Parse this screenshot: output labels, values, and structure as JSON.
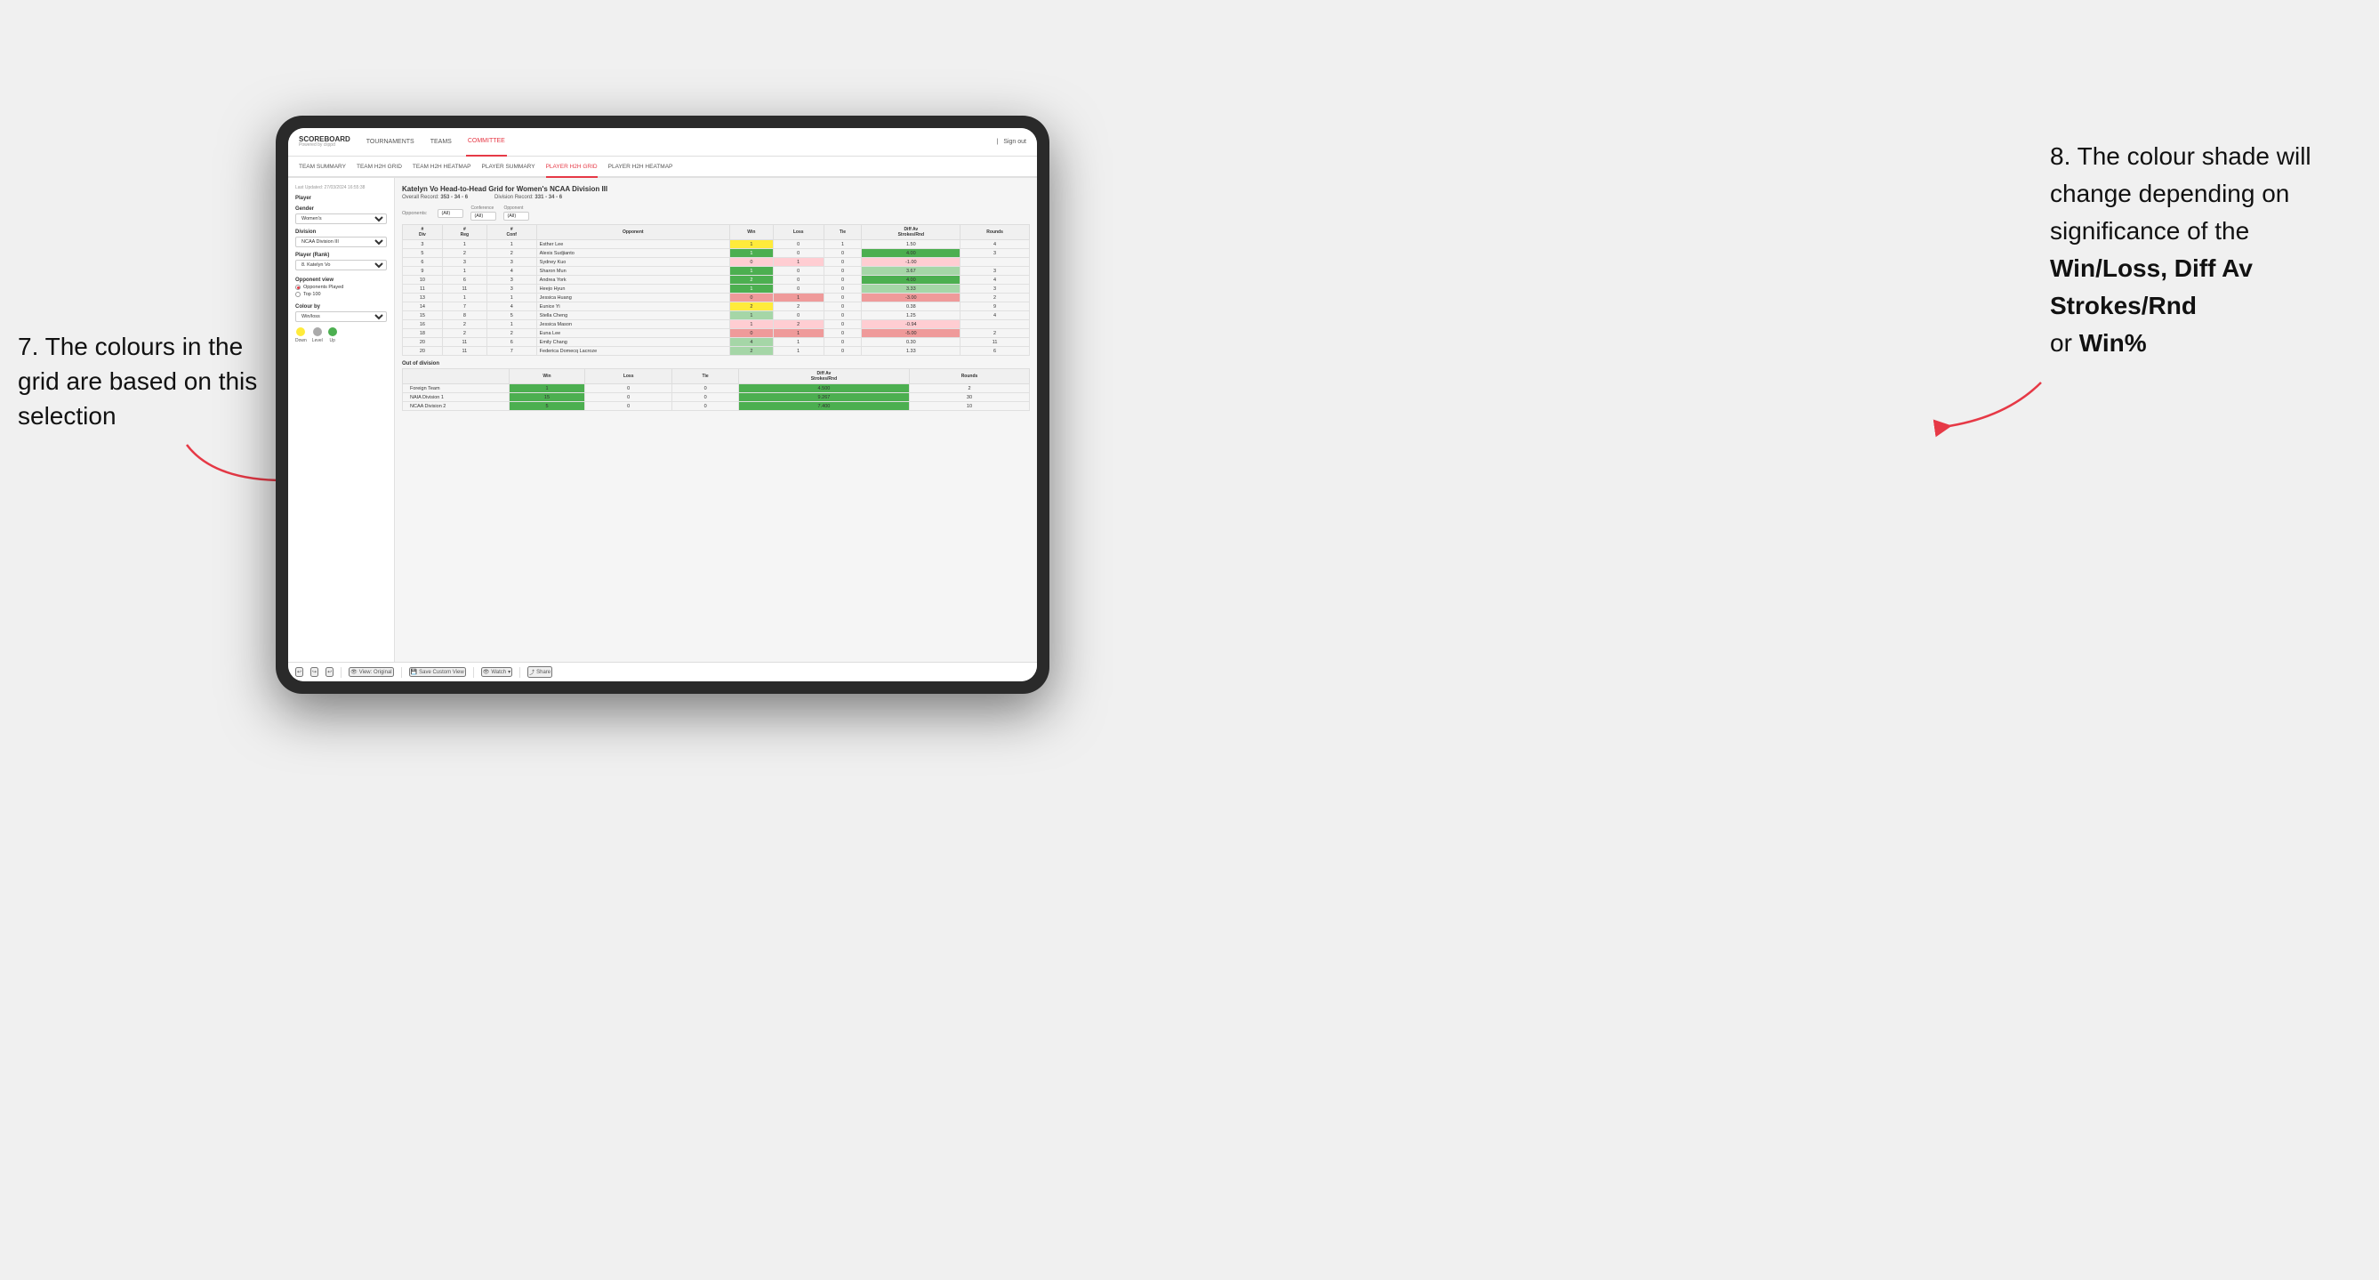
{
  "annotations": {
    "left_title": "7. The colours in the grid are based on this selection",
    "right_title": "8. The colour shade will change depending on significance of the",
    "right_bold1": "Win/Loss,",
    "right_bold2": "Diff Av Strokes/Rnd",
    "right_text": "or",
    "right_bold3": "Win%"
  },
  "nav": {
    "logo": "SCOREBOARD",
    "logo_sub": "Powered by clippd",
    "items": [
      "TOURNAMENTS",
      "TEAMS",
      "COMMITTEE"
    ],
    "active": "COMMITTEE",
    "right": "Sign out"
  },
  "sub_nav": {
    "items": [
      "TEAM SUMMARY",
      "TEAM H2H GRID",
      "TEAM H2H HEATMAP",
      "PLAYER SUMMARY",
      "PLAYER H2H GRID",
      "PLAYER H2H HEATMAP"
    ],
    "active": "PLAYER H2H GRID"
  },
  "sidebar": {
    "timestamp": "Last Updated: 27/03/2024 16:55:38",
    "player_label": "Player",
    "gender_label": "Gender",
    "gender_value": "Women's",
    "division_label": "Division",
    "division_value": "NCAA Division III",
    "player_rank_label": "Player (Rank)",
    "player_rank_value": "8. Katelyn Vo",
    "opponent_view_label": "Opponent view",
    "radio1": "Opponents Played",
    "radio2": "Top 100",
    "radio1_selected": true,
    "colour_by_label": "Colour by",
    "colour_by_value": "Win/loss",
    "legend": {
      "down": "Down",
      "level": "Level",
      "up": "Up"
    }
  },
  "grid": {
    "title": "Katelyn Vo Head-to-Head Grid for Women's NCAA Division III",
    "overall_record": "353 - 34 - 6",
    "division_record": "331 - 34 - 6",
    "filter_opponents_label": "Opponents:",
    "filter_opponents_value": "(All)",
    "filter_conference_label": "Conference",
    "filter_conference_value": "(All)",
    "filter_opponent_label": "Opponent",
    "filter_opponent_value": "(All)",
    "col_headers": [
      "#\nDiv",
      "#\nReg",
      "#\nConf",
      "Opponent",
      "Win",
      "Loss",
      "Tie",
      "Diff Av\nStrokes/Rnd",
      "Rounds"
    ],
    "rows": [
      {
        "div": "3",
        "reg": "1",
        "conf": "1",
        "opponent": "Esther Lee",
        "win": "1",
        "loss": "0",
        "tie": "1",
        "diff": "1.50",
        "rounds": "4",
        "win_color": "yellow",
        "diff_color": ""
      },
      {
        "div": "5",
        "reg": "2",
        "conf": "2",
        "opponent": "Alexis Sudjianto",
        "win": "1",
        "loss": "0",
        "tie": "0",
        "diff": "4.00",
        "rounds": "3",
        "win_color": "green_dark",
        "diff_color": "green_dark"
      },
      {
        "div": "6",
        "reg": "3",
        "conf": "3",
        "opponent": "Sydney Kuo",
        "win": "0",
        "loss": "1",
        "tie": "0",
        "diff": "-1.00",
        "rounds": "",
        "win_color": "red_light",
        "diff_color": "red_light"
      },
      {
        "div": "9",
        "reg": "1",
        "conf": "4",
        "opponent": "Sharon Mun",
        "win": "1",
        "loss": "0",
        "tie": "0",
        "diff": "3.67",
        "rounds": "3",
        "win_color": "green_dark",
        "diff_color": "green_light"
      },
      {
        "div": "10",
        "reg": "6",
        "conf": "3",
        "opponent": "Andrea York",
        "win": "2",
        "loss": "0",
        "tie": "0",
        "diff": "4.00",
        "rounds": "4",
        "win_color": "green_dark",
        "diff_color": "green_dark"
      },
      {
        "div": "11",
        "reg": "11",
        "conf": "3",
        "opponent": "Heejo Hyun",
        "win": "1",
        "loss": "0",
        "tie": "0",
        "diff": "3.33",
        "rounds": "3",
        "win_color": "green_dark",
        "diff_color": "green_light"
      },
      {
        "div": "13",
        "reg": "1",
        "conf": "1",
        "opponent": "Jessica Huang",
        "win": "0",
        "loss": "1",
        "tie": "0",
        "diff": "-3.00",
        "rounds": "2",
        "win_color": "red",
        "diff_color": "red"
      },
      {
        "div": "14",
        "reg": "7",
        "conf": "4",
        "opponent": "Eunice Yi",
        "win": "2",
        "loss": "2",
        "tie": "0",
        "diff": "0.38",
        "rounds": "9",
        "win_color": "yellow",
        "diff_color": ""
      },
      {
        "div": "15",
        "reg": "8",
        "conf": "5",
        "opponent": "Stella Cheng",
        "win": "1",
        "loss": "0",
        "tie": "0",
        "diff": "1.25",
        "rounds": "4",
        "win_color": "green_light",
        "diff_color": ""
      },
      {
        "div": "16",
        "reg": "2",
        "conf": "1",
        "opponent": "Jessica Mason",
        "win": "1",
        "loss": "2",
        "tie": "0",
        "diff": "-0.94",
        "rounds": "",
        "win_color": "red_light",
        "diff_color": "red_light"
      },
      {
        "div": "18",
        "reg": "2",
        "conf": "2",
        "opponent": "Euna Lee",
        "win": "0",
        "loss": "1",
        "tie": "0",
        "diff": "-5.00",
        "rounds": "2",
        "win_color": "red",
        "diff_color": "red"
      },
      {
        "div": "20",
        "reg": "11",
        "conf": "6",
        "opponent": "Emily Chang",
        "win": "4",
        "loss": "1",
        "tie": "0",
        "diff": "0.30",
        "rounds": "11",
        "win_color": "green_light",
        "diff_color": ""
      },
      {
        "div": "20",
        "reg": "11",
        "conf": "7",
        "opponent": "Federica Domecq Lacroze",
        "win": "2",
        "loss": "1",
        "tie": "0",
        "diff": "1.33",
        "rounds": "6",
        "win_color": "green_light",
        "diff_color": ""
      }
    ],
    "out_of_division_label": "Out of division",
    "out_rows": [
      {
        "opponent": "Foreign Team",
        "win": "1",
        "loss": "0",
        "tie": "0",
        "diff": "4.500",
        "rounds": "2",
        "win_color": "green_dark"
      },
      {
        "opponent": "NAIA Division 1",
        "win": "15",
        "loss": "0",
        "tie": "0",
        "diff": "9.267",
        "rounds": "30",
        "win_color": "green_dark"
      },
      {
        "opponent": "NCAA Division 2",
        "win": "5",
        "loss": "0",
        "tie": "0",
        "diff": "7.400",
        "rounds": "10",
        "win_color": "green_dark"
      }
    ]
  },
  "toolbar": {
    "view_original": "View: Original",
    "save_custom": "Save Custom View",
    "watch": "Watch",
    "share": "Share"
  }
}
